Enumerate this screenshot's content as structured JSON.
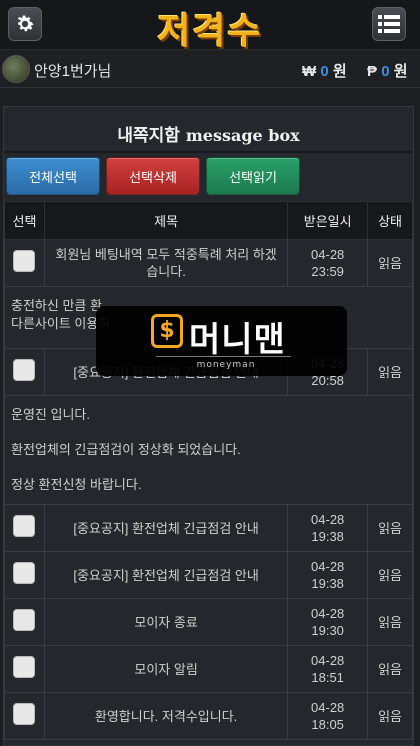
{
  "header": {
    "logo_text": "저격수",
    "settings_icon": "gear-icon",
    "menu_icon": "list-menu-icon"
  },
  "user": {
    "name": "안양1번가님",
    "won_symbol": "₩",
    "won_value": "0",
    "won_unit": "원",
    "point_symbol": "₱",
    "point_value": "0",
    "point_unit": "원"
  },
  "panel": {
    "title": "내쪽지함",
    "title_en": "message box",
    "buttons": {
      "select_all": "전체선택",
      "delete_selected": "선택삭제",
      "read_selected": "선택읽기"
    }
  },
  "table": {
    "headers": [
      "선택",
      "제목",
      "받은일시",
      "상태"
    ],
    "rows": [
      {
        "subject": "회원님 베팅내역 모두 적중특례 처리 하겠습니다.",
        "date": "04-28",
        "time": "23:59",
        "status": "읽음"
      },
      {
        "subject": "[중요공지] 환전업체 긴급점검 안내",
        "date": "04-28",
        "time": "20:58",
        "status": "읽음"
      },
      {
        "subject": "[중요공지] 환전업체 긴급점검 안내",
        "date": "04-28",
        "time": "19:38",
        "status": "읽음"
      },
      {
        "subject": "[중요공지] 환전업체 긴급점검 안내",
        "date": "04-28",
        "time": "19:38",
        "status": "읽음"
      },
      {
        "subject": "모이자 종료",
        "date": "04-28",
        "time": "19:30",
        "status": "읽음"
      },
      {
        "subject": "모이자 알림",
        "date": "04-28",
        "time": "18:51",
        "status": "읽음"
      },
      {
        "subject": "환영합니다. 저격수입니다.",
        "date": "04-28",
        "time": "18:05",
        "status": "읽음"
      }
    ],
    "message1": [
      "충전하신 만큼 환",
      "다른사이트 이용하"
    ],
    "message2": [
      "운영진 입니다.",
      "환전업체의 긴급점검이 정상화 되었습니다.",
      "정상 환전신청 바랍니다."
    ]
  },
  "watermark": {
    "icon_glyph": "$",
    "text": "머니맨",
    "sub": "moneyman"
  },
  "colors": {
    "accent_blue": "#3b8fe0",
    "logo_gold": "#f2b21a",
    "btn_blue": "#3f8fd0",
    "btn_red": "#d04040",
    "btn_green": "#2aa06a"
  }
}
